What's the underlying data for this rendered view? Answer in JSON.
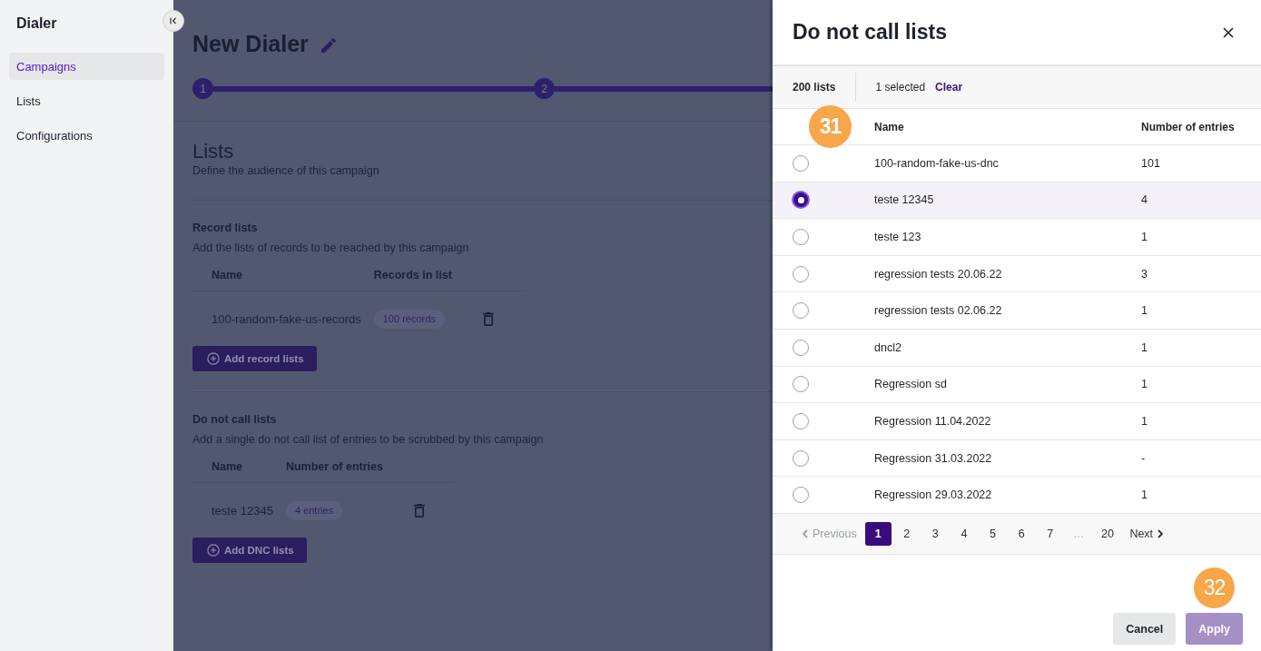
{
  "sidebar": {
    "title": "Dialer",
    "items": [
      {
        "label": "Campaigns",
        "selected": true
      },
      {
        "label": "Lists",
        "selected": false
      },
      {
        "label": "Configurations",
        "selected": false
      }
    ]
  },
  "page": {
    "title": "New Dialer",
    "steps": [
      {
        "number": "1"
      },
      {
        "number": "2"
      }
    ],
    "section": {
      "title": "Lists",
      "subtitle": "Define the audience of this campaign"
    },
    "groups": [
      {
        "title": "Record lists",
        "description": "Add the lists of records to be reached by this campaign",
        "columns": [
          "Name",
          "Records in list"
        ],
        "rows": [
          {
            "name": "100-random-fake-us-records",
            "badge": "100 records"
          }
        ],
        "button": "Add record lists"
      },
      {
        "title": "Do not call lists",
        "description": "Add a single do not call list of entries to be scrubbed by this campaign",
        "columns": [
          "Name",
          "Number of entries"
        ],
        "rows": [
          {
            "name": "teste 12345",
            "badge": "4 entries"
          }
        ],
        "button": "Add DNC lists"
      }
    ]
  },
  "panel": {
    "title": "Do not call lists",
    "toolbar": {
      "count": "200 lists",
      "selection": "1 selected",
      "clear": "Clear"
    },
    "table": {
      "callout": "31",
      "columns": [
        "Name",
        "Number of entries"
      ],
      "rows": [
        {
          "name": "100-random-fake-us-dnc",
          "entries": "101",
          "selected": false
        },
        {
          "name": "teste 12345",
          "entries": "4",
          "selected": true
        },
        {
          "name": "teste 123",
          "entries": "1",
          "selected": false
        },
        {
          "name": "regression tests 20.06.22",
          "entries": "3",
          "selected": false
        },
        {
          "name": "regression tests 02.06.22",
          "entries": "1",
          "selected": false
        },
        {
          "name": "dncl2",
          "entries": "1",
          "selected": false
        },
        {
          "name": "Regression sd",
          "entries": "1",
          "selected": false
        },
        {
          "name": "Regression 11.04.2022",
          "entries": "1",
          "selected": false
        },
        {
          "name": "Regression 31.03.2022",
          "entries": "-",
          "selected": false
        },
        {
          "name": "Regression 29.03.2022",
          "entries": "1",
          "selected": false
        }
      ]
    },
    "pagination": {
      "previous": {
        "label": "Previous",
        "disabled": true
      },
      "pages": [
        {
          "kind": "page",
          "label": "1",
          "selected": true
        },
        {
          "kind": "page",
          "label": "2",
          "selected": false
        },
        {
          "kind": "page",
          "label": "3",
          "selected": false
        },
        {
          "kind": "page",
          "label": "4",
          "selected": false
        },
        {
          "kind": "page",
          "label": "5",
          "selected": false
        },
        {
          "kind": "page",
          "label": "6",
          "selected": false
        },
        {
          "kind": "page",
          "label": "7",
          "selected": false
        },
        {
          "kind": "ellipsis",
          "label": "..."
        },
        {
          "kind": "page",
          "label": "20",
          "selected": false
        }
      ],
      "next": {
        "label": "Next",
        "disabled": false
      }
    },
    "footer": {
      "callout": "32",
      "buttons": [
        {
          "kind": "secondary",
          "label": "Cancel",
          "disabled": false
        },
        {
          "kind": "primary",
          "label": "Apply",
          "disabled": true
        }
      ]
    }
  }
}
